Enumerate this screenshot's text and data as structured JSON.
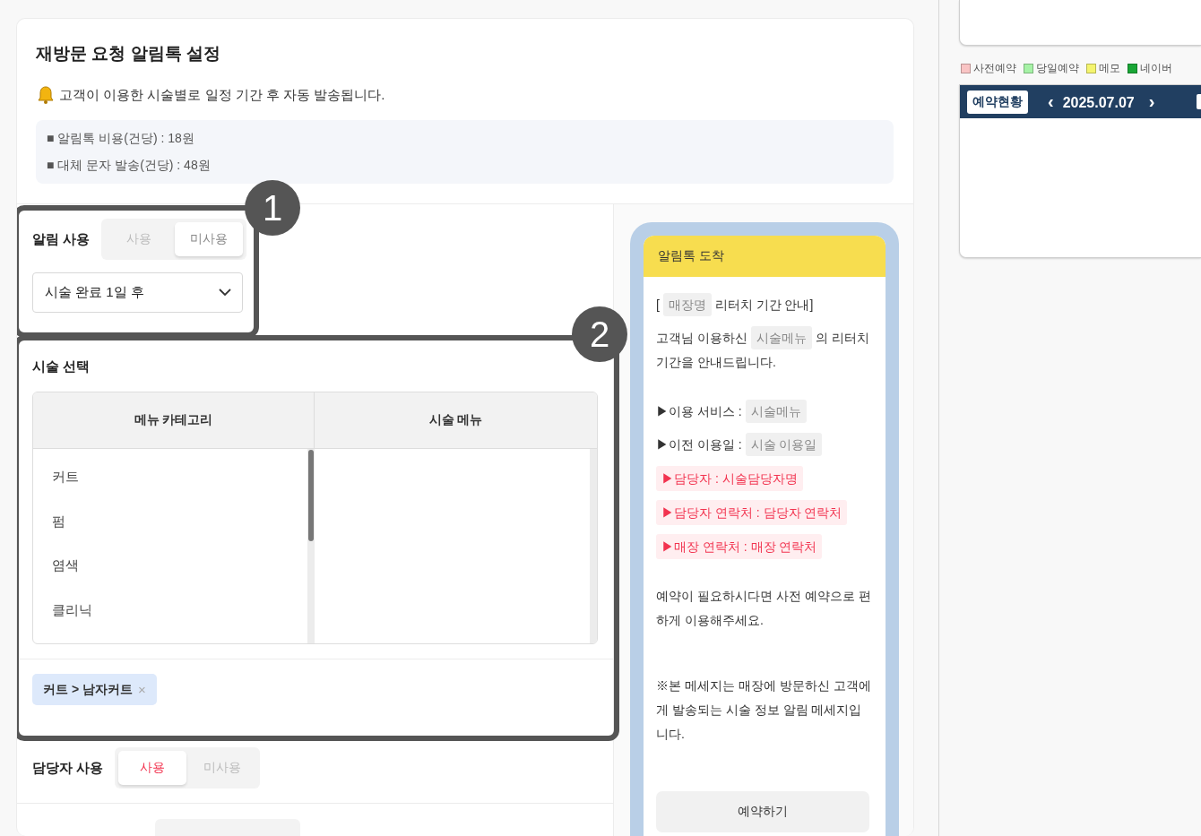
{
  "header": {
    "title": "재방문 요청 알림톡 설정",
    "notice": "고객이 이용한 시술별로 일정 기간 후 자동 발송됩니다.",
    "info": [
      "■ 알림톡 비용(건당) : 18원",
      "■ 대체 문자 발송(건당) : 48원"
    ]
  },
  "alarm": {
    "label": "알림 사용",
    "options": [
      {
        "label": "사용",
        "selected": false
      },
      {
        "label": "미사용",
        "selected": true
      }
    ],
    "select": {
      "value": "시술 완료 1일 후"
    }
  },
  "service": {
    "title": "시술 선택",
    "columns": [
      "메뉴 카테고리",
      "시술 메뉴"
    ],
    "categories": [
      {
        "label": "커트",
        "selected": false
      },
      {
        "label": "펌",
        "selected": false
      },
      {
        "label": "염색",
        "selected": false
      },
      {
        "label": "클리닉",
        "selected": false
      }
    ],
    "tags": [
      {
        "label": "커트 > 남자커트",
        "remove": "×"
      }
    ]
  },
  "staff": {
    "label": "담당자 사용",
    "options": [
      {
        "label": "사용",
        "selected": true
      },
      {
        "label": "미사용",
        "selected": false
      }
    ]
  },
  "preview": {
    "title": "알림톡 도착",
    "lines": [
      {
        "kind": "text",
        "parts": [
          {
            "text": "[ "
          },
          {
            "text": "매장명",
            "kind": "var"
          },
          {
            "text": " 리터치 기간 안내]"
          }
        ]
      },
      {
        "kind": "text",
        "parts": [
          {
            "text": "고객님 이용하신 "
          },
          {
            "text": "시술메뉴",
            "kind": "var"
          },
          {
            "text": " 의 리터치 기간을 안내드립니다."
          }
        ]
      },
      {
        "kind": "blank"
      },
      {
        "kind": "text",
        "parts": [
          {
            "text": "▶이용 서비스 : "
          },
          {
            "text": "시술메뉴",
            "kind": "var"
          }
        ]
      },
      {
        "kind": "text",
        "parts": [
          {
            "text": "▶이전 이용일 : "
          },
          {
            "text": "시술 이용일",
            "kind": "var"
          }
        ]
      },
      {
        "kind": "highlight",
        "text": "▶담당자 : 시술담당자명"
      },
      {
        "kind": "highlight",
        "text": "▶담당자 연락처 : 담당자 연락처"
      },
      {
        "kind": "highlight",
        "text": "▶매장 연락처 : 매장 연락처"
      },
      {
        "kind": "blank"
      },
      {
        "kind": "text",
        "parts": [
          {
            "text": "예약이 필요하시다면 사전 예약으로 편하게 이용해주세요."
          }
        ]
      },
      {
        "kind": "blank"
      },
      {
        "kind": "blank"
      },
      {
        "kind": "text",
        "parts": [
          {
            "text": "※본 메세지는 매장에 방문하신 고객에게 발송되는 시술 정보 알림 메세지입니다."
          }
        ]
      }
    ],
    "button": "예약하기"
  },
  "annotations": [
    {
      "number": "1"
    },
    {
      "number": "2"
    }
  ],
  "side": {
    "legend": [
      {
        "label": "사전예약",
        "color": "#f9c4c4"
      },
      {
        "label": "당일예약",
        "color": "#a6f2a6"
      },
      {
        "label": "메모",
        "color": "#f4f46e"
      },
      {
        "label": "네이버",
        "color": "#19a636"
      }
    ],
    "tab": "예약현황",
    "prev": "‹",
    "date": "2025.07.07",
    "next": "›"
  }
}
